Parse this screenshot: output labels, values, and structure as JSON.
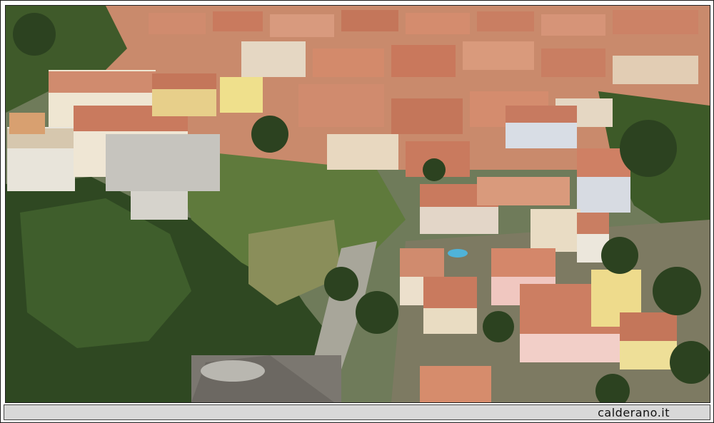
{
  "photo": {
    "subject": "aerial-town-view",
    "colors": {
      "roof": "#c9785c",
      "roof_light": "#d99a7c",
      "wall": "#e8d8c0",
      "vegetation": "#3f5a2a",
      "vegetation_dark": "#2c4220",
      "grass": "#7c8a4e",
      "road": "#9a9a94",
      "pool": "#4fb3d9"
    }
  },
  "caption": {
    "text": "calderano.it"
  }
}
